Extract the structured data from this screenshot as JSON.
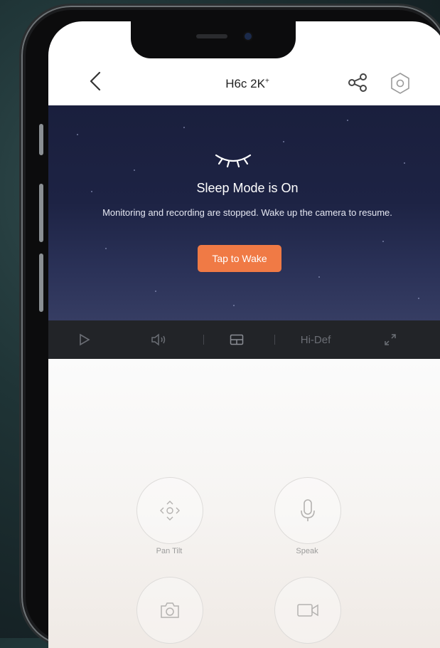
{
  "header": {
    "title": "H6c 2K",
    "title_sup": "+"
  },
  "sleep": {
    "title": "Sleep Mode is On",
    "description": "Monitoring and recording are stopped. Wake up the camera to resume.",
    "wake_label": "Tap to Wake"
  },
  "toolbar": {
    "quality_label": "Hi-Def"
  },
  "controls": {
    "items": [
      {
        "label": "Pan Tilt"
      },
      {
        "label": "Speak"
      },
      {
        "label": ""
      },
      {
        "label": ""
      }
    ]
  },
  "colors": {
    "accent": "#f07a45",
    "video_bg": "#1d2344",
    "toolbar_bg": "#222428"
  },
  "icons": [
    "back-chevron-icon",
    "share-icon",
    "gear-icon",
    "closed-eye-icon",
    "play-icon",
    "speaker-icon",
    "grid-layout-icon",
    "fullscreen-icon",
    "pan-tilt-icon",
    "microphone-icon",
    "camera-icon",
    "video-record-icon"
  ]
}
